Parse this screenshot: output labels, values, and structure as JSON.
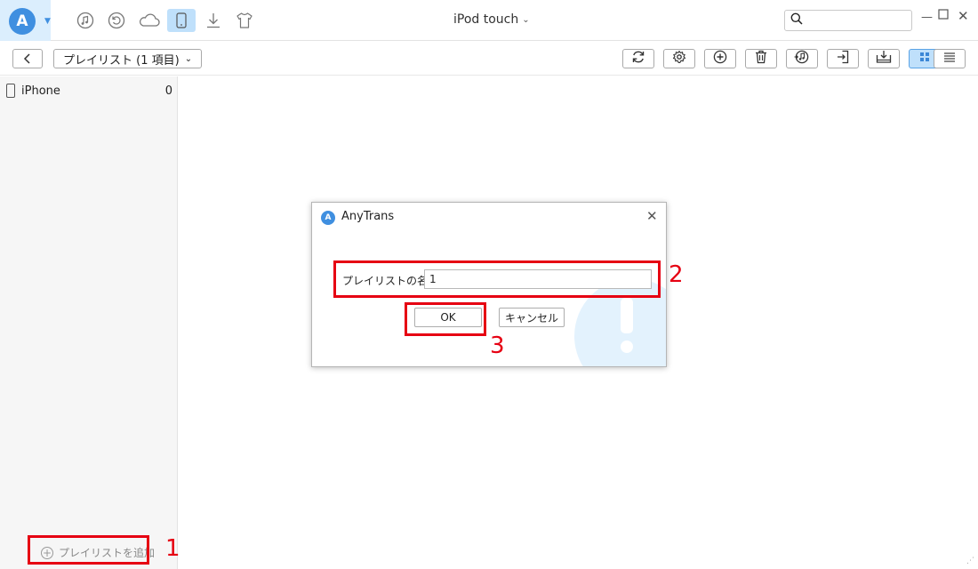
{
  "app": {
    "title": "AnyTrans",
    "device_title": "iPod touch"
  },
  "top_icons": [
    "music-icon",
    "history-icon",
    "cloud-icon",
    "device-icon",
    "download-icon",
    "shirt-icon"
  ],
  "toolbar": {
    "playlist_select": "プレイリスト (1 項目)",
    "buttons": [
      "refresh-icon",
      "settings-icon",
      "add-icon",
      "delete-icon",
      "to-itunes-icon",
      "export-icon",
      "to-pc-icon",
      "grid-view-icon",
      "list-view-icon"
    ]
  },
  "sidebar": {
    "items": [
      {
        "label": "iPhone",
        "count": "0"
      }
    ],
    "add_playlist": "プレイリストを追加"
  },
  "dialog": {
    "title": "AnyTrans",
    "field_label": "プレイリストの名前:",
    "field_value": "1",
    "ok_label": "OK",
    "cancel_label": "キャンセル"
  },
  "annotations": {
    "one": "1",
    "two": "2",
    "three": "3"
  },
  "colors": {
    "accent": "#3f8fe0",
    "highlight": "#e60012",
    "active_bg": "#bfe0fb"
  }
}
